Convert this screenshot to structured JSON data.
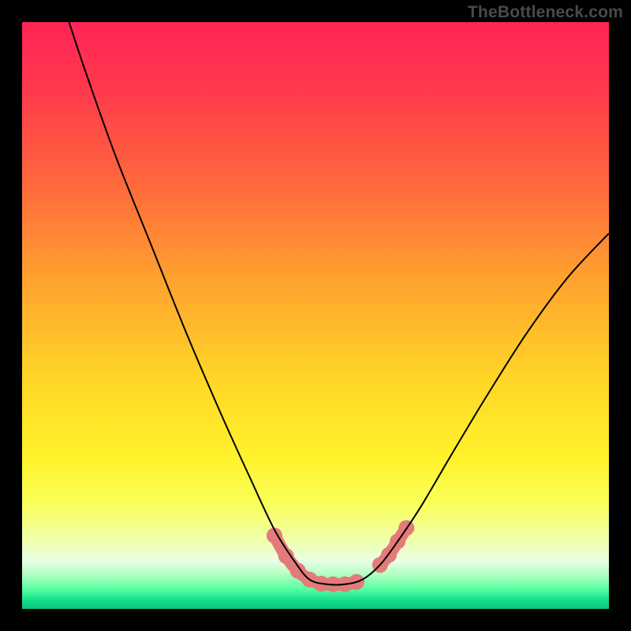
{
  "watermark": "TheBottleneck.com",
  "chart_data": {
    "type": "line",
    "title": "",
    "xlabel": "",
    "ylabel": "",
    "xlim": [
      0,
      100
    ],
    "ylim": [
      0,
      100
    ],
    "background_gradient": {
      "stops": [
        {
          "offset": 0.0,
          "color": "#ff2556"
        },
        {
          "offset": 0.12,
          "color": "#ff3a4c"
        },
        {
          "offset": 0.28,
          "color": "#ff6a3c"
        },
        {
          "offset": 0.44,
          "color": "#ffa22e"
        },
        {
          "offset": 0.6,
          "color": "#ffd427"
        },
        {
          "offset": 0.74,
          "color": "#fff22a"
        },
        {
          "offset": 0.82,
          "color": "#f9ff58"
        },
        {
          "offset": 0.885,
          "color": "#f0ffb0"
        },
        {
          "offset": 0.918,
          "color": "#e9ffe6"
        },
        {
          "offset": 0.94,
          "color": "#b6ffc4"
        },
        {
          "offset": 0.965,
          "color": "#5cffa2"
        },
        {
          "offset": 0.985,
          "color": "#15e08b"
        },
        {
          "offset": 1.0,
          "color": "#0cc47e"
        }
      ]
    },
    "series": [
      {
        "name": "bottleneck-curve",
        "color": "#000000",
        "width": 2.0,
        "points": [
          {
            "x": 8.0,
            "y": 100.0
          },
          {
            "x": 11.0,
            "y": 91.0
          },
          {
            "x": 16.0,
            "y": 77.0
          },
          {
            "x": 22.0,
            "y": 62.0
          },
          {
            "x": 28.0,
            "y": 47.0
          },
          {
            "x": 34.0,
            "y": 33.0
          },
          {
            "x": 39.0,
            "y": 22.0
          },
          {
            "x": 43.0,
            "y": 13.5
          },
          {
            "x": 46.5,
            "y": 8.0
          },
          {
            "x": 49.0,
            "y": 5.0
          },
          {
            "x": 52.0,
            "y": 4.2
          },
          {
            "x": 55.0,
            "y": 4.2
          },
          {
            "x": 58.0,
            "y": 5.0
          },
          {
            "x": 61.0,
            "y": 7.5
          },
          {
            "x": 64.0,
            "y": 11.5
          },
          {
            "x": 68.0,
            "y": 17.5
          },
          {
            "x": 73.0,
            "y": 26.0
          },
          {
            "x": 79.0,
            "y": 36.0
          },
          {
            "x": 86.0,
            "y": 47.0
          },
          {
            "x": 93.0,
            "y": 56.5
          },
          {
            "x": 100.0,
            "y": 64.0
          }
        ]
      },
      {
        "name": "marker-band-left",
        "type": "marker-band",
        "color": "#e37b7a",
        "points": [
          {
            "x": 43.0,
            "y": 12.5
          },
          {
            "x": 45.0,
            "y": 9.0
          },
          {
            "x": 47.0,
            "y": 6.5
          },
          {
            "x": 49.0,
            "y": 5.0
          },
          {
            "x": 51.0,
            "y": 4.3
          },
          {
            "x": 53.0,
            "y": 4.2
          },
          {
            "x": 55.0,
            "y": 4.2
          },
          {
            "x": 57.0,
            "y": 4.6
          }
        ]
      },
      {
        "name": "marker-band-right",
        "type": "marker-band",
        "color": "#e37b7a",
        "points": [
          {
            "x": 61.0,
            "y": 7.5
          },
          {
            "x": 62.5,
            "y": 9.2
          },
          {
            "x": 64.0,
            "y": 11.5
          },
          {
            "x": 65.5,
            "y": 13.8
          }
        ]
      }
    ]
  }
}
